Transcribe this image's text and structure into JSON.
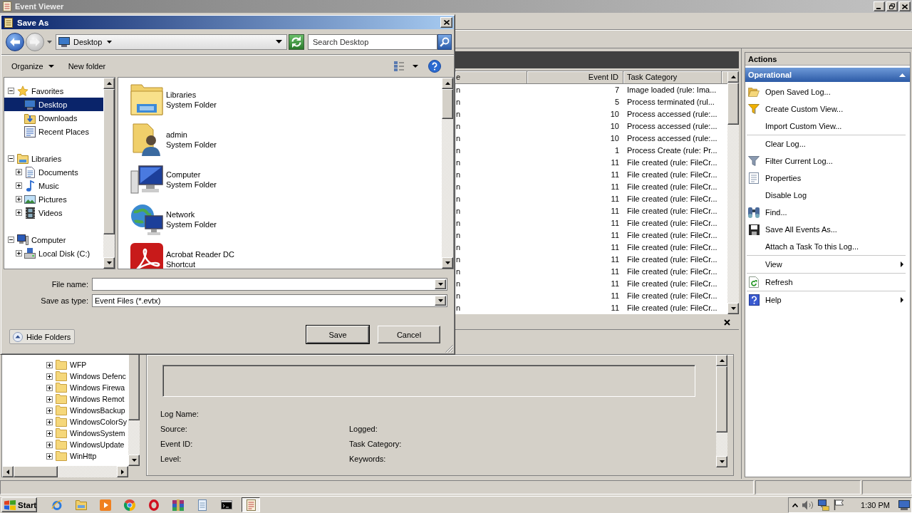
{
  "window": {
    "title": "Event Viewer"
  },
  "log_tree": {
    "items": [
      {
        "label": "WFP",
        "expanded": false
      },
      {
        "label": "Windows Defenc",
        "expanded": false
      },
      {
        "label": "Windows Firewa",
        "expanded": false
      },
      {
        "label": "Windows Remot",
        "expanded": false
      },
      {
        "label": "WindowsBackup",
        "expanded": false
      },
      {
        "label": "WindowsColorSy",
        "expanded": false
      },
      {
        "label": "WindowsSystem",
        "expanded": false
      },
      {
        "label": "WindowsUpdate",
        "expanded": false
      },
      {
        "label": "WinHttp",
        "expanded": false
      }
    ]
  },
  "event_list": {
    "columns": [
      "e",
      "Event ID",
      "Task Category"
    ],
    "rows": [
      {
        "column_1": "n",
        "event_id": "7",
        "task_category": "Image loaded (rule: Ima..."
      },
      {
        "column_1": "n",
        "event_id": "5",
        "task_category": "Process terminated (rul..."
      },
      {
        "column_1": "n",
        "event_id": "10",
        "task_category": "Process accessed (rule:..."
      },
      {
        "column_1": "n",
        "event_id": "10",
        "task_category": "Process accessed (rule:..."
      },
      {
        "column_1": "n",
        "event_id": "10",
        "task_category": "Process accessed (rule:..."
      },
      {
        "column_1": "n",
        "event_id": "1",
        "task_category": "Process Create (rule: Pr..."
      },
      {
        "column_1": "n",
        "event_id": "11",
        "task_category": "File created (rule: FileCr..."
      },
      {
        "column_1": "n",
        "event_id": "11",
        "task_category": "File created (rule: FileCr..."
      },
      {
        "column_1": "n",
        "event_id": "11",
        "task_category": "File created (rule: FileCr..."
      },
      {
        "column_1": "n",
        "event_id": "11",
        "task_category": "File created (rule: FileCr..."
      },
      {
        "column_1": "n",
        "event_id": "11",
        "task_category": "File created (rule: FileCr..."
      },
      {
        "column_1": "n",
        "event_id": "11",
        "task_category": "File created (rule: FileCr..."
      },
      {
        "column_1": "n",
        "event_id": "11",
        "task_category": "File created (rule: FileCr..."
      },
      {
        "column_1": "n",
        "event_id": "11",
        "task_category": "File created (rule: FileCr..."
      },
      {
        "column_1": "n",
        "event_id": "11",
        "task_category": "File created (rule: FileCr..."
      },
      {
        "column_1": "n",
        "event_id": "11",
        "task_category": "File created (rule: FileCr..."
      },
      {
        "column_1": "n",
        "event_id": "11",
        "task_category": "File created (rule: FileCr..."
      },
      {
        "column_1": "n",
        "event_id": "11",
        "task_category": "File created (rule: FileCr..."
      },
      {
        "column_1": "n",
        "event_id": "11",
        "task_category": "File created (rule: FileCr..."
      }
    ]
  },
  "details": {
    "fields": [
      {
        "left": "Log Name:"
      },
      {
        "left": "Source:",
        "right": "Logged:"
      },
      {
        "left": "Event ID:",
        "right": "Task Category:"
      },
      {
        "left": "Level:",
        "right": "Keywords:"
      }
    ]
  },
  "actions": {
    "title": "Actions",
    "section": {
      "title": "Operational",
      "expanded": true
    },
    "groups": [
      {
        "items": [
          {
            "label": "Open Saved Log...",
            "submenu": false
          },
          {
            "label": "Create Custom View...",
            "submenu": false
          },
          {
            "label": "Import Custom View...",
            "submenu": false
          }
        ]
      },
      {
        "items": [
          {
            "label": "Clear Log...",
            "submenu": false
          },
          {
            "label": "Filter Current Log...",
            "submenu": false
          },
          {
            "label": "Properties",
            "submenu": false
          },
          {
            "label": "Disable Log",
            "submenu": false
          },
          {
            "label": "Find...",
            "submenu": false
          },
          {
            "label": "Save All Events As...",
            "submenu": false
          },
          {
            "label": "Attach a Task To this Log...",
            "submenu": false
          }
        ]
      },
      {
        "items": [
          {
            "label": "View",
            "submenu": true
          }
        ]
      },
      {
        "items": [
          {
            "label": "Refresh",
            "submenu": false
          }
        ]
      },
      {
        "items": [
          {
            "label": "Help",
            "submenu": true
          }
        ]
      }
    ]
  },
  "taskbar": {
    "start": "Start",
    "apps": [
      {
        "selected": false
      },
      {
        "selected": false
      },
      {
        "selected": false
      },
      {
        "selected": false
      },
      {
        "selected": false
      },
      {
        "selected": false
      },
      {
        "selected": false
      },
      {
        "selected": false
      },
      {
        "selected": true
      }
    ],
    "clock": "1:30 PM"
  },
  "dialog": {
    "title": "Save As",
    "address": "Desktop",
    "search": {
      "placeholder": "Search Desktop"
    },
    "commands": {
      "organize": "Organize",
      "new_folder": "New folder"
    },
    "nav": [
      {
        "label": "Favorites",
        "expanded": true,
        "selected": false,
        "children": [
          {
            "label": "Desktop",
            "selected": true
          },
          {
            "label": "Downloads",
            "selected": false
          },
          {
            "label": "Recent Places",
            "selected": false
          }
        ]
      },
      {
        "label": "Libraries",
        "expanded": true,
        "selected": false,
        "children": [
          {
            "label": "Documents",
            "expanded": false,
            "selected": false
          },
          {
            "label": "Music",
            "expanded": false,
            "selected": false
          },
          {
            "label": "Pictures",
            "expanded": false,
            "selected": false
          },
          {
            "label": "Videos",
            "expanded": false,
            "selected": false
          }
        ]
      },
      {
        "label": "Computer",
        "expanded": true,
        "selected": false,
        "children": [
          {
            "label": "Local Disk (C:)",
            "expanded": false,
            "selected": false
          }
        ]
      }
    ],
    "files": [
      {
        "name": "Libraries",
        "type": "System Folder"
      },
      {
        "name": "admin",
        "type": "System Folder"
      },
      {
        "name": "Computer",
        "type": "System Folder"
      },
      {
        "name": "Network",
        "type": "System Folder"
      },
      {
        "name": "Acrobat Reader DC",
        "type": "Shortcut"
      }
    ],
    "file_name": {
      "label": "File name:"
    },
    "save_as_type": {
      "label": "Save as type:",
      "value": "Event Files (*.evtx)"
    },
    "hide_folders": "Hide Folders",
    "buttons": [
      {
        "label": "Save",
        "default": true
      },
      {
        "label": "Cancel",
        "default": false
      }
    ]
  }
}
